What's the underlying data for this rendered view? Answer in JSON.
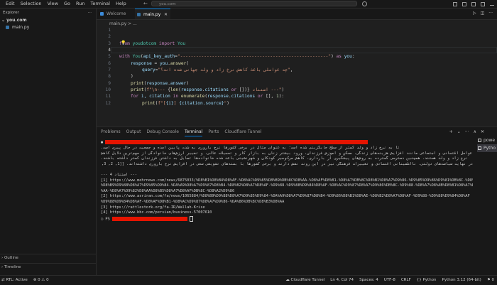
{
  "menu": [
    "Edit",
    "Selection",
    "View",
    "Go",
    "Run",
    "Terminal",
    "Help"
  ],
  "command_center": "you.com",
  "sidebar": {
    "title": "Explorer",
    "more": "···",
    "folder": "you.com",
    "file": "main.py",
    "sections": [
      "Outline",
      "Timeline"
    ]
  },
  "tabs": [
    {
      "label": "Welcome",
      "icon": "vscode-icon",
      "color": "#3c8bd9"
    },
    {
      "label": "main.py",
      "icon": "python-icon",
      "color": "#3572a5"
    }
  ],
  "breadcrumb": "main.py  > ...",
  "code": {
    "line_numbers": [
      "1",
      "2",
      "3",
      "4",
      "5",
      "6",
      "7",
      "8",
      "9",
      "10",
      "11",
      "12"
    ],
    "l2": [
      "from",
      " youdotcom ",
      "import",
      " You"
    ],
    "l4": [
      "with",
      " ",
      "You",
      "(",
      "api_key_auth",
      "=",
      "\"--------------------------------------------------------\"",
      ")",
      " as ",
      "you",
      ":"
    ],
    "l5": [
      "response",
      " = ",
      "you",
      ".",
      "answer",
      "("
    ],
    "l6": [
      "query",
      "=",
      "\"چه عواملی باعث کاهش نرخ زاد و ولد جهانی شده اند؟\"",
      ","
    ],
    "l7": [
      ")"
    ],
    "l8": [
      "print",
      "(",
      "response",
      ".",
      "answer",
      ")"
    ],
    "l9": [
      "print",
      "(",
      "f\"\\n--- ",
      "{",
      "len",
      "(",
      "response",
      ".",
      "citations",
      " or ",
      "[]",
      ")",
      "}",
      " استناد ---\"",
      ")"
    ],
    "l10": [
      "for",
      " i, citation ",
      "in",
      " ",
      "enumerate",
      "(",
      "response",
      ".",
      "citations",
      " or ",
      "[]",
      ", ",
      "1",
      "):"
    ],
    "l11": [
      "print",
      "(",
      "f\"[",
      "{i}",
      "] ",
      "{citation.source}",
      "\"",
      ")"
    ]
  },
  "panel": {
    "tabs": [
      "Problems",
      "Output",
      "Debug Console",
      "Terminal",
      "Ports",
      "Cloudflare Tunnel"
    ],
    "active_tab": "Terminal",
    "actions": [
      "+",
      "⌄",
      "···",
      "∧",
      "✕"
    ],
    "shells": [
      "powe",
      "Pytho"
    ]
  },
  "terminal": {
    "rtl_lines": [
      "تا به نرخ زاد و ولد کمتر از سطح جایگزینی شده است؛ به عنوان مثال در برخی کشورها نرخ باروری به شدت پایین آمده و جمعیت در حال پیری است.",
      "عوامل اقتصادی و اجتماعی مانند افزایش هزینه‌های زندگی، مسکن و آموزش فرزندان، ورود بیشتر زنان به بازار کار و تحصیلات عالی، و تغییر ارزش‌های خانوادگی از مهم‌ترین دلایل کاهش",
      "نرخ زاد و ولد هستند. همچنین دسترسی گسترده به روش‌های پیشگیری از بارداری، کاهش مرگ‌ومیر کودکان و شهرنشینی باعث شده خانواده‌ها تمایل به داشتن فرزندان کمتر داشته باشند.",
      "در نهایت سیاست‌های دولتی، نااطمینانی اقتصادی و تغییرات فرهنگی نیز در این روند نقش دارند و برخی کشورها با بسته‌های تشویقی سعی در افزایش نرخ باروری داشته‌اند. [[1, 2, 3, 4]]"
    ],
    "citations_header": "--- 4 استناد ---",
    "citations": [
      "[1] https://www.mehrnews.com/news/6875033/%D8%B1%D8%B4%D8%AF-%D8%AC%D9%85%D8%B9%DB%8C%D8%AA-%D8%AF%D8%B1-%D8%A7%DB%8C%D8%B1%D8%A7%D9%86-%D9%85%D9%86%D9%81%DB%8C-%D8%B4%D8%AF",
      "%D8%B9%D9%88%D8%A7%D9%85%D9%84-%DA%A9%D8%A7%D9%87%D8%B4-%D8%B2%D8%A7%D8%AF-%D9%88-%D9%88%D9%84%D8%AF-%D8%AC%D9%87%D8%A7%D9%86%DB%8C-%D9%88-%D8%A7%D8%AB%D8%B1%D8%A7%D8%AA",
      "%AA-%D8%A7%D9%82%D8%AA%D8%B5%D8%A7%D8%AF%DB%8C-%D8%A2%D9%86",
      "[2] https://www.asriran.com/fa/news/1065884/%D8%B9%D9%88%D8%A7%D9%85%D9%84-%DA%A9%D8%A7%D9%87%D8%B4-%D9%86%D8%B1%D8%AE-%D8%B2%D8%A7%D8%AF-%D9%88-%D9%88%D9%84%D8%AF",
      "%D9%88%D9%84%D8%AF-%D8%AF%D8%B1-%D8%AC%D9%87%D8%A7%D9%86-%DA%86%DB%8C%D8%B3%D8%AA",
      "[3] https://rattlestork.org/fa-IR/Wallah-Krise",
      "[4] https://www.bbc.com/persian/business-57007610"
    ],
    "prompt": "PS"
  },
  "status": {
    "left": [
      "⇄ RTL: Active",
      "⊗ 0  ⚠ 0"
    ],
    "right": [
      "☁ Cloudflare Tunnel",
      "Ln 4, Col 74",
      "Spaces: 4",
      "UTF-8",
      "CRLF",
      "{} Python",
      "Python 3.12 (64-bit)",
      "⚑ 0"
    ]
  },
  "colors": {
    "accent": "#0078d4",
    "redaction": "#e51400"
  }
}
